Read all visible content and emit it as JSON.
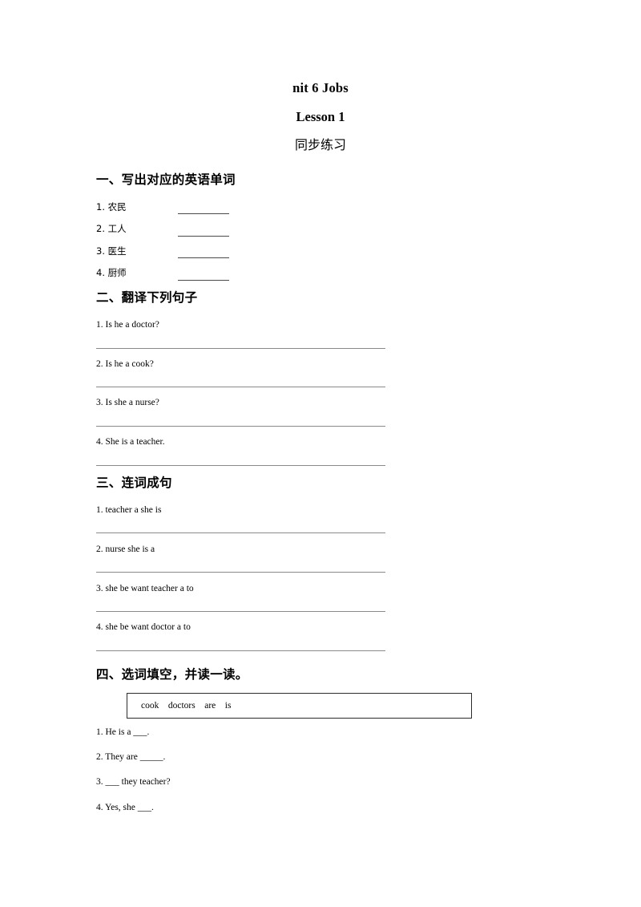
{
  "document": {
    "title": "nit 6 Jobs",
    "subtitle": "Lesson 1",
    "subtitle2": "同步练习"
  },
  "sections": [
    {
      "heading": "一、写出对应的英语单词",
      "items": [
        {
          "text": "1. 农民"
        },
        {
          "text": "2. 工人"
        },
        {
          "text": "3. 医生"
        },
        {
          "text": "4. 厨师"
        }
      ]
    },
    {
      "heading": "二、翻译下列句子",
      "items": [
        {
          "text": "1. Is he a doctor?"
        },
        {
          "text": "2. Is he a cook?"
        },
        {
          "text": "3. Is she a nurse?"
        },
        {
          "text": "4. She is a teacher."
        }
      ]
    },
    {
      "heading": "三、连词成句",
      "items": [
        {
          "text": "1. teacher a she is"
        },
        {
          "text": "2. nurse she is a"
        },
        {
          "text": "3. she be want teacher a to"
        },
        {
          "text": "4. she be want doctor a to"
        }
      ]
    },
    {
      "heading": "四、选词填空，并读一读。",
      "word_bank": "cook    doctors    are    is",
      "items": [
        {
          "text": "1. He is a ___."
        },
        {
          "text": "2. They are _____."
        },
        {
          "text": "3. ___ they teacher?"
        },
        {
          "text": "4. Yes, she ___."
        }
      ]
    }
  ]
}
